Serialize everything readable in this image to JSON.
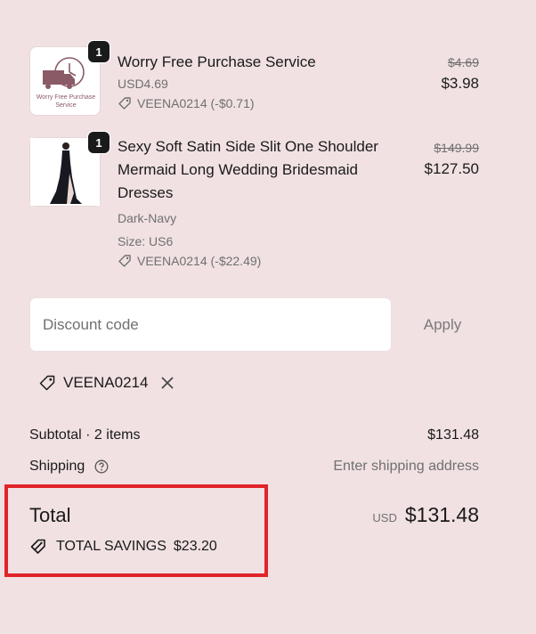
{
  "items": [
    {
      "quantity": "1",
      "thumb_text": "Worry Free Purchase Service",
      "title": "Worry Free Purchase Service",
      "meta_lines": [
        "USD4.69"
      ],
      "discount": "VEENA0214 (-$0.71)",
      "original_price": "$4.69",
      "price": "$3.98"
    },
    {
      "quantity": "1",
      "title": "Sexy Soft Satin Side Slit One Shoulder Mermaid Long Wedding Bridesmaid Dresses",
      "meta_lines": [
        "Dark-Navy",
        "Size: US6"
      ],
      "discount": "VEENA0214 (-$22.49)",
      "original_price": "$149.99",
      "price": "$127.50"
    }
  ],
  "discount": {
    "placeholder": "Discount code",
    "apply_label": "Apply",
    "applied_code": "VEENA0214"
  },
  "summary": {
    "subtotal_label": "Subtotal · 2 items",
    "subtotal_value": "$131.48",
    "shipping_label": "Shipping",
    "shipping_value": "Enter shipping address",
    "total_label": "Total",
    "currency": "USD",
    "total_value": "$131.48",
    "savings_label": "TOTAL SAVINGS",
    "savings_value": "$23.20"
  },
  "colors": {
    "background": "#f1e1e2",
    "highlight": "#e0242a",
    "muted_text": "#707070"
  }
}
